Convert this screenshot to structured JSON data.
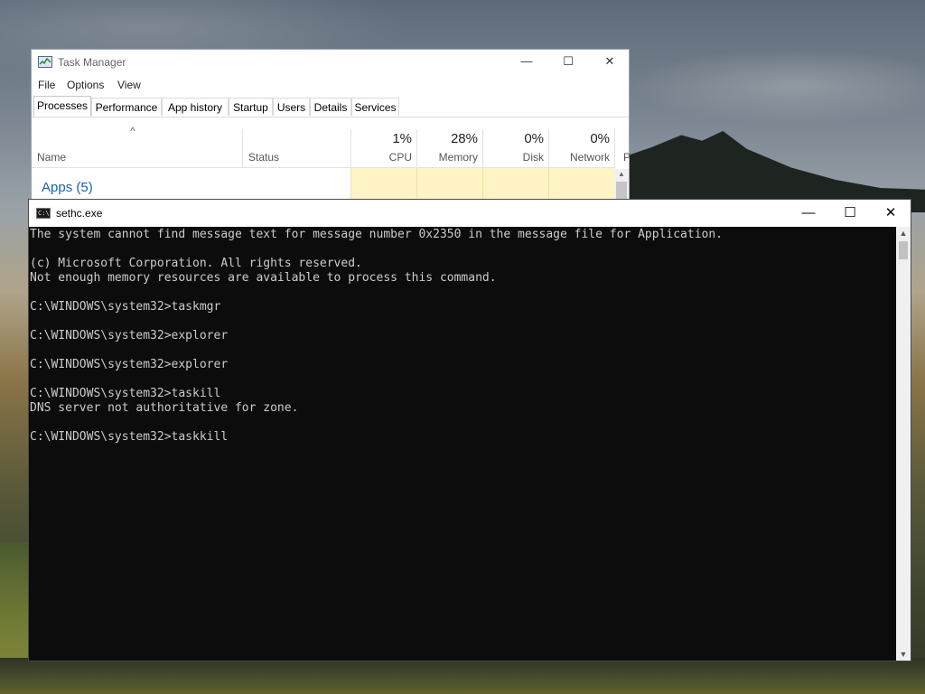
{
  "task_manager": {
    "title": "Task Manager",
    "controls": {
      "minimize": "—",
      "maximize": "☐",
      "close": "✕"
    },
    "menu": [
      "File",
      "Options",
      "View"
    ],
    "tabs": [
      "Processes",
      "Performance",
      "App history",
      "Startup",
      "Users",
      "Details",
      "Services"
    ],
    "active_tab": "Processes",
    "columns": {
      "name": "Name",
      "status": "Status",
      "cpu": {
        "percent": "1%",
        "label": "CPU"
      },
      "memory": {
        "percent": "28%",
        "label": "Memory"
      },
      "disk": {
        "percent": "0%",
        "label": "Disk"
      },
      "network": {
        "percent": "0%",
        "label": "Network"
      },
      "power_truncated": "P"
    },
    "group": "Apps (5)",
    "sort_arrow": "^"
  },
  "console": {
    "title": "sethc.exe",
    "icon_text": "C:\\",
    "controls": {
      "minimize": "—",
      "maximize": "☐",
      "close": "✕"
    },
    "lines": [
      "The system cannot find message text for message number 0x2350 in the message file for Application.",
      "",
      "(c) Microsoft Corporation. All rights reserved.",
      "Not enough memory resources are available to process this command.",
      "",
      "C:\\WINDOWS\\system32>taskmgr",
      "",
      "C:\\WINDOWS\\system32>explorer",
      "",
      "C:\\WINDOWS\\system32>explorer",
      "",
      "C:\\WINDOWS\\system32>taskill",
      "DNS server not authoritative for zone.",
      "",
      "C:\\WINDOWS\\system32>taskkill"
    ],
    "scroll_up": "▲",
    "scroll_down": "▼"
  },
  "colors": {
    "console_bg": "#0c0c0c",
    "console_text": "#cccccc",
    "tm_group_blue": "#1a5fb4",
    "tm_heat": "#fff4c6"
  }
}
